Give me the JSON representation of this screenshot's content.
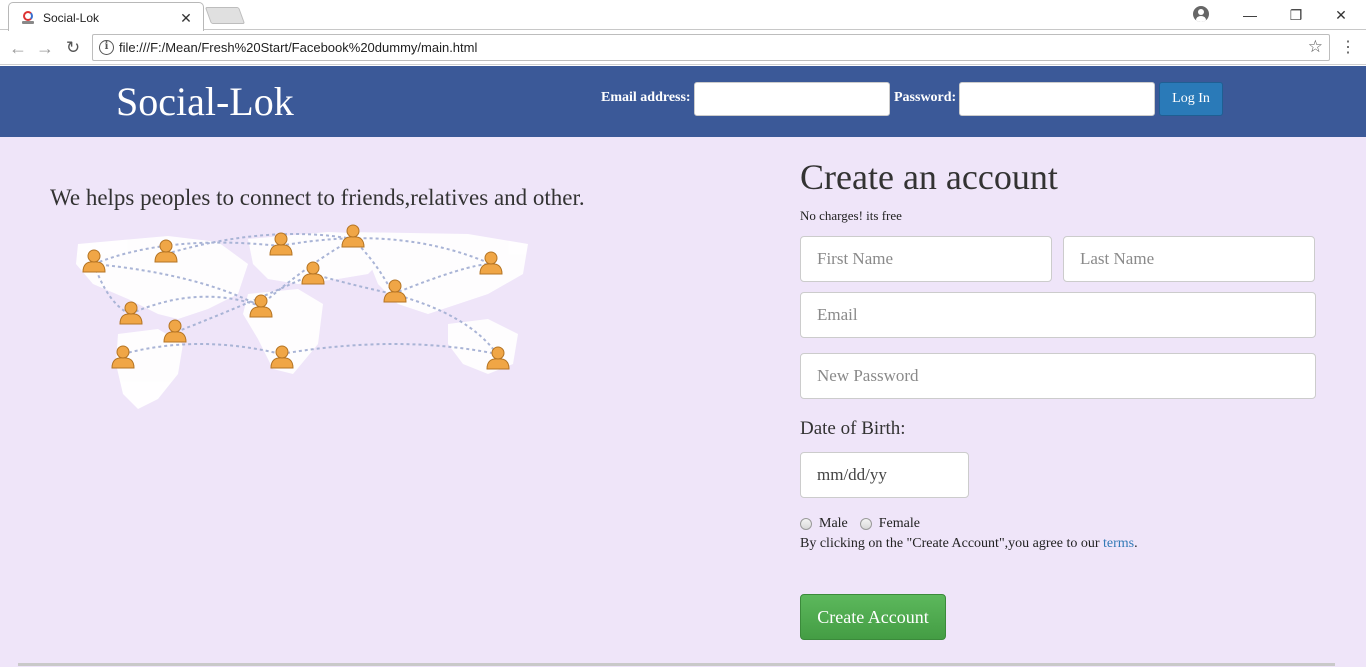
{
  "browser": {
    "tab_title": "Social-Lok",
    "tab_close": "✕",
    "url": "file:///F:/Mean/Fresh%20Start/Facebook%20dummy/main.html",
    "back_icon": "arrow-left-icon",
    "forward_icon": "arrow-right-icon",
    "reload_icon": "reload-icon",
    "star_icon": "star-icon",
    "minimize": "—",
    "restore": "❐",
    "close": "✕"
  },
  "header": {
    "brand": "Social-Lok",
    "email_label": "Email address:",
    "password_label": "Password:",
    "login_button": "Log In",
    "background_color": "#3b5998"
  },
  "main": {
    "tagline": "We helps peoples to connect to friends,relatives and other.",
    "map_icon": "world-map-people-network"
  },
  "signup": {
    "title": "Create an account",
    "subtitle": "No charges! its free",
    "first_name_placeholder": "First Name",
    "last_name_placeholder": "Last Name",
    "email_placeholder": "Email",
    "password_placeholder": "New Password",
    "dob_label": "Date of Birth:",
    "dob_placeholder": "mm/dd/yy",
    "gender_male": "Male",
    "gender_female": "Female",
    "terms_text": "By clicking on the \"Create Account\",you agree to our ",
    "terms_link": "terms",
    "terms_end": ".",
    "create_button": "Create Account",
    "button_color": "#449d44"
  },
  "colors": {
    "page_background": "#efe5f9",
    "link": "#337ab7"
  }
}
